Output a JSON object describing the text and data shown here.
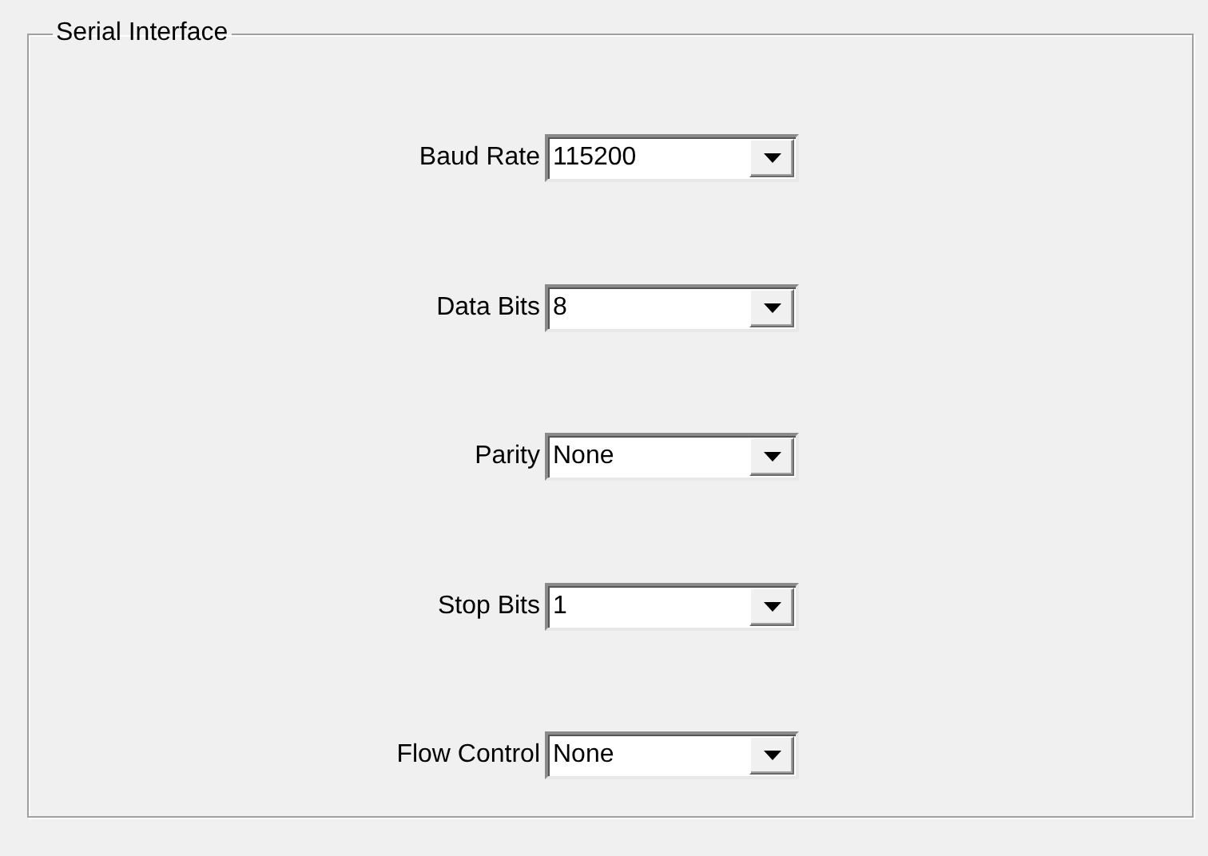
{
  "group": {
    "title": "Serial Interface",
    "fields": [
      {
        "label": "Baud Rate",
        "value": "115200"
      },
      {
        "label": "Data Bits",
        "value": "8"
      },
      {
        "label": "Parity",
        "value": "None"
      },
      {
        "label": "Stop Bits",
        "value": "1"
      },
      {
        "label": "Flow Control",
        "value": "None"
      }
    ]
  }
}
